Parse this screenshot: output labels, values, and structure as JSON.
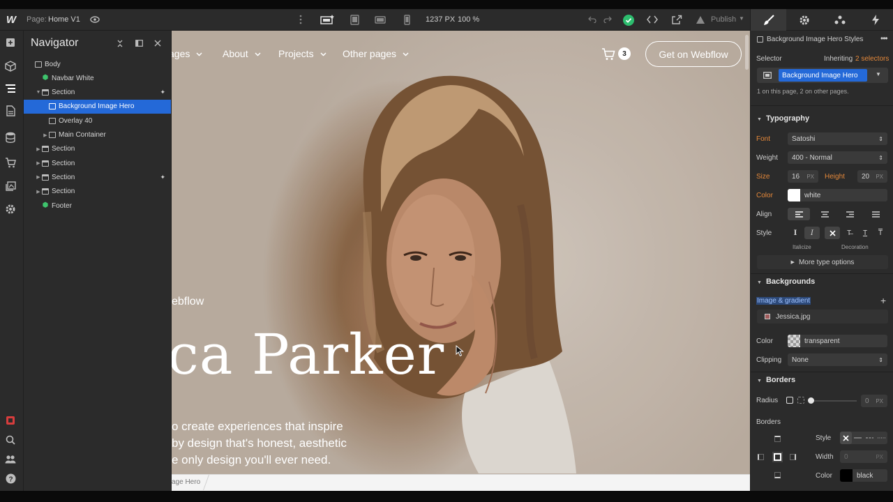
{
  "topbar": {
    "logo": "W",
    "page_prefix": "Page:",
    "page_name": "Home V1",
    "dimensions": "1237 PX",
    "zoom": "100 %",
    "publish_label": "Publish",
    "icons": [
      "webflow-logo",
      "eye-icon",
      "more-vert-icon",
      "desktop-star-icon",
      "tablet-icon",
      "mobile-landscape-icon",
      "mobile-portrait-icon",
      "undo-icon",
      "redo-icon",
      "check-circle-icon",
      "code-icon",
      "share-icon",
      "publish-icon",
      "chevron-down-icon"
    ]
  },
  "left_rail": {
    "icons": [
      "add-panel-icon",
      "components-icon",
      "navigator-icon",
      "pages-icon",
      "cms-icon",
      "ecommerce-icon",
      "assets-icon",
      "settings-icon",
      "audit-icon",
      "search-icon",
      "users-icon",
      "help-icon"
    ]
  },
  "navigator": {
    "title": "Navigator",
    "tree": [
      {
        "label": "Body",
        "depth": 0,
        "type": "body",
        "toggle": ""
      },
      {
        "label": "Navbar White",
        "depth": 1,
        "type": "symbol",
        "toggle": ""
      },
      {
        "label": "Section",
        "depth": 1,
        "type": "section",
        "toggle": "open",
        "plus": true
      },
      {
        "label": "Background Image Hero",
        "depth": 2,
        "type": "box",
        "toggle": "",
        "selected": true
      },
      {
        "label": "Overlay 40",
        "depth": 2,
        "type": "box",
        "toggle": ""
      },
      {
        "label": "Main Container",
        "depth": 2,
        "type": "box",
        "toggle": "closed"
      },
      {
        "label": "Section",
        "depth": 1,
        "type": "section",
        "toggle": "closed"
      },
      {
        "label": "Section",
        "depth": 1,
        "type": "section",
        "toggle": "closed"
      },
      {
        "label": "Section",
        "depth": 1,
        "type": "section",
        "toggle": "closed",
        "plus": true
      },
      {
        "label": "Section",
        "depth": 1,
        "type": "section",
        "toggle": "closed"
      },
      {
        "label": "Footer",
        "depth": 1,
        "type": "symbol",
        "toggle": ""
      }
    ]
  },
  "canvas": {
    "nav_links": [
      "ages",
      "About",
      "Projects",
      "Other pages"
    ],
    "cart_count": "3",
    "cta": "Get on Webflow",
    "eyebrow": "ebflow",
    "hero_title": "ca Parker",
    "hero_lines": [
      "o create experiences that inspire",
      "by design that's honest, aesthetic",
      "e only design you'll ever need."
    ],
    "breadcrumb": "age Hero"
  },
  "style_panel": {
    "tabs": [
      "style-brush-icon",
      "settings-gear-icon",
      "interactions-drops-icon",
      "lightning-icon"
    ],
    "element_title": "Background Image Hero Styles",
    "selector_label": "Selector",
    "inheriting_text": "Inheriting",
    "inheriting_count": "2 selectors",
    "selector_chip": "Background Image Hero",
    "selector_note": "1 on this page, 2 on other pages.",
    "typography": {
      "header": "Typography",
      "font_label": "Font",
      "font_value": "Satoshi",
      "weight_label": "Weight",
      "weight_value": "400 - Normal",
      "size_label": "Size",
      "size_value": "16",
      "size_unit": "PX",
      "height_label": "Height",
      "height_value": "20",
      "height_unit": "PX",
      "color_label": "Color",
      "color_value": "white",
      "color_swatch": "#ffffff",
      "align_label": "Align",
      "style_label": "Style",
      "italicize_label": "Italicize",
      "decoration_label": "Decoration",
      "more_label": "More type options"
    },
    "backgrounds": {
      "header": "Backgrounds",
      "image_gradient_label": "Image & gradient",
      "image_file": "Jessica.jpg",
      "color_label": "Color",
      "color_value": "transparent",
      "clipping_label": "Clipping",
      "clipping_value": "None"
    },
    "borders": {
      "header": "Borders",
      "radius_label": "Radius",
      "radius_value": "0",
      "radius_unit": "PX",
      "borders_label": "Borders",
      "style_label": "Style",
      "width_label": "Width",
      "width_value": "0",
      "width_unit": "PX",
      "color_label": "Color",
      "color_value": "black",
      "color_swatch": "#000000"
    },
    "colors": {
      "accent": "#2469d8",
      "orange": "#e6893a",
      "success": "#2dbd6e"
    }
  }
}
